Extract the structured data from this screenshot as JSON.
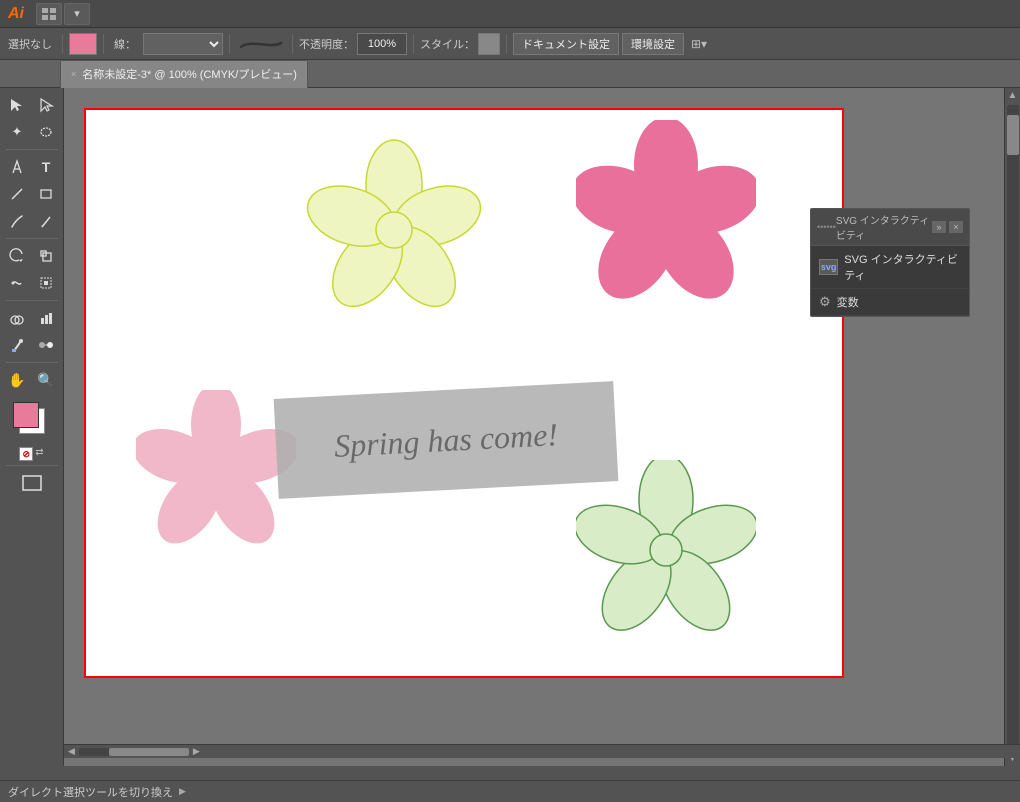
{
  "app": {
    "name": "Ai",
    "title": "Adobe Illustrator"
  },
  "menubar": {
    "icons": [
      "grid-menu",
      "chevron-down"
    ]
  },
  "toolbar": {
    "selection_label": "選択なし",
    "stroke_label": "線：",
    "opacity_label": "不透明度：",
    "opacity_value": "100%",
    "style_label": "スタイル：",
    "doc_settings_label": "ドキュメント設定",
    "env_settings_label": "環境設定"
  },
  "tabbar": {
    "tab_title": "名称未設定-3* @ 100% (CMYK/プレビュー)",
    "close_label": "×"
  },
  "canvas": {
    "text_content": "Spring has come!"
  },
  "svg_panel": {
    "title": "SVG インタラクティビティ",
    "variables_label": "変数",
    "close_btn": "×",
    "expand_btn": "»"
  },
  "statusbar": {
    "label": "ダイレクト選択ツールを切り換え",
    "arrow": "▶"
  },
  "colors": {
    "flower_yellow_fill": "#eef5c0",
    "flower_yellow_stroke": "#c8d830",
    "flower_pink_large": "#e8709a",
    "flower_pink_small": "#f0b8c8",
    "flower_green_fill": "#d8ecc8",
    "flower_green_stroke": "#5a9850",
    "text_box_bg": "#b0b0b0",
    "canvas_border": "red"
  }
}
